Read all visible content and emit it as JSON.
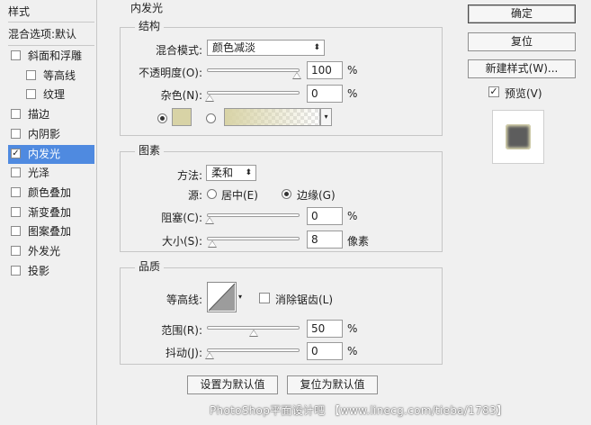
{
  "sidebar": {
    "styles_header": "样式",
    "blending_header": "混合选项:默认",
    "items": [
      {
        "label": "斜面和浮雕",
        "checked": false,
        "sub": false,
        "selected": false
      },
      {
        "label": "等高线",
        "checked": false,
        "sub": true,
        "selected": false
      },
      {
        "label": "纹理",
        "checked": false,
        "sub": true,
        "selected": false
      },
      {
        "label": "描边",
        "checked": false,
        "sub": false,
        "selected": false
      },
      {
        "label": "内阴影",
        "checked": false,
        "sub": false,
        "selected": false
      },
      {
        "label": "内发光",
        "checked": true,
        "sub": false,
        "selected": true
      },
      {
        "label": "光泽",
        "checked": false,
        "sub": false,
        "selected": false
      },
      {
        "label": "颜色叠加",
        "checked": false,
        "sub": false,
        "selected": false
      },
      {
        "label": "渐变叠加",
        "checked": false,
        "sub": false,
        "selected": false
      },
      {
        "label": "图案叠加",
        "checked": false,
        "sub": false,
        "selected": false
      },
      {
        "label": "外发光",
        "checked": false,
        "sub": false,
        "selected": false
      },
      {
        "label": "投影",
        "checked": false,
        "sub": false,
        "selected": false
      }
    ]
  },
  "panel": {
    "title": "内发光",
    "structure": {
      "legend": "结构",
      "blend_mode_label": "混合模式:",
      "blend_mode_value": "颜色减淡",
      "opacity_label": "不透明度(O):",
      "opacity_value": "100",
      "opacity_unit": "%",
      "opacity_level": 1.0,
      "noise_label": "杂色(N):",
      "noise_value": "0",
      "noise_unit": "%",
      "noise_level": 0.0,
      "swatch_color": "#d8d3a6"
    },
    "elements": {
      "legend": "图素",
      "method_label": "方法:",
      "method_value": "柔和",
      "source_label": "源:",
      "source_center": "居中(E)",
      "source_edge": "边缘(G)",
      "choke_label": "阻塞(C):",
      "choke_value": "0",
      "choke_unit": "%",
      "choke_level": 0.0,
      "size_label": "大小(S):",
      "size_value": "8",
      "size_unit": "像素",
      "size_level": 0.03
    },
    "quality": {
      "legend": "品质",
      "contour_label": "等高线:",
      "antialias_label": "消除锯齿(L)",
      "range_label": "范围(R):",
      "range_value": "50",
      "range_unit": "%",
      "range_level": 0.5,
      "jitter_label": "抖动(J):",
      "jitter_value": "0",
      "jitter_unit": "%",
      "jitter_level": 0.0
    },
    "make_default": "设置为默认值",
    "reset_default": "复位为默认值"
  },
  "buttons": {
    "ok": "确定",
    "reset": "复位",
    "new_style": "新建样式(W)...",
    "preview_label": "预览(V)",
    "preview_checked": true
  },
  "watermark": "PhotoShop平面设计吧 【www.linecg.com/tieba/1783】"
}
